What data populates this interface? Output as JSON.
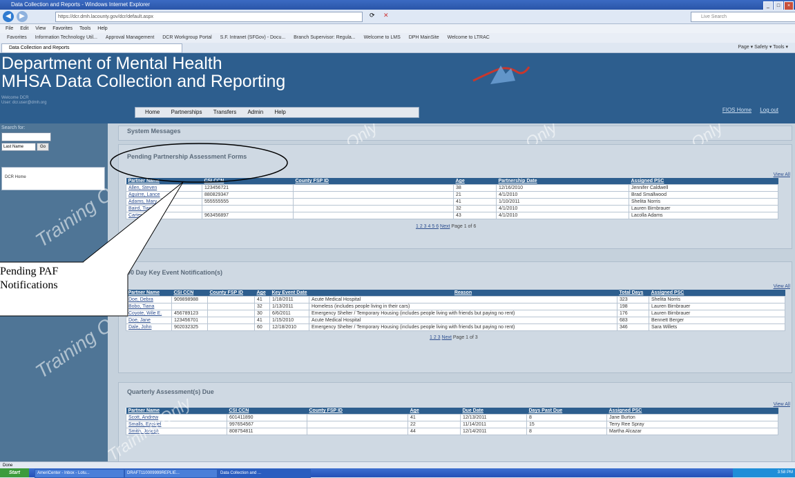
{
  "browser": {
    "title": "Data Collection and Reports - Windows Internet Explorer",
    "url": "https://dcr.dmh.lacounty.gov/dcr/default.aspx",
    "search_placeholder": "Live Search",
    "menu": [
      "File",
      "Edit",
      "View",
      "Favorites",
      "Tools",
      "Help"
    ],
    "favorites": [
      "Favorites",
      "Information Technology Util...",
      "Approval Management",
      "DCR Workgroup Portal",
      "S.F. Intranet (SFGov) - Docu...",
      "Branch Supervisor: Regula...",
      "Welcome to LMS",
      "DPH MainSite",
      "Welcome to LTRAC"
    ],
    "tab_label": "Data Collection and Reports",
    "command_bar": "Page ▾  Safety ▾  Tools ▾",
    "status": "Done"
  },
  "header": {
    "title1": "Department of Mental Health",
    "title2": "MHSA Data Collection and Reporting",
    "user_line1": "Welcome DCR",
    "user_line2": "User: dcr.user@dmh.org",
    "nav": [
      "Home",
      "Partnerships",
      "Transfers",
      "Admin",
      "Help"
    ],
    "links": [
      "FIOS Home",
      "Log out"
    ]
  },
  "sidebar": {
    "search_label": "Search for:",
    "search_select": "Last Name",
    "go": "Go",
    "box_item": "DCR Home"
  },
  "watermark": "Training Only",
  "system_messages": {
    "title": "System Messages"
  },
  "paf": {
    "title": "Pending Partnership Assessment Forms",
    "view_all": "View All",
    "columns": [
      "Partner Name",
      "CSI CCN",
      "County FSP ID",
      "Age",
      "Partnership Date",
      "Assigned PSC"
    ],
    "rows": [
      [
        "Allen, Steven",
        "123456721",
        "",
        "38",
        "12/16/2010",
        "Jennifer Caldwell"
      ],
      [
        "Aguirre, Lance",
        "880829347",
        "",
        "21",
        "4/1/2010",
        "Brad Smallwood"
      ],
      [
        "Adams, Mary",
        "555555555",
        "",
        "41",
        "1/10/2011",
        "Shelita Norris"
      ],
      [
        "Baird, Tiana",
        "",
        "",
        "32",
        "4/1/2010",
        "Lauren Birnbrauer"
      ],
      [
        "Carter, Carlos",
        "963456897",
        "",
        "43",
        "4/1/2010",
        "Lacolla Adams"
      ]
    ],
    "pager_pages": "1 2 3 4 5 6",
    "pager_next": "Next",
    "pager_info": "Page 1 of 6"
  },
  "kev": {
    "title": "90 Day Key Event Notification(s)",
    "view_all": "View All",
    "columns": [
      "Partner Name",
      "CSI CCN",
      "County FSP ID",
      "Age",
      "Key Event Date",
      "Reason",
      "Total Days",
      "Assigned PSC"
    ],
    "rows": [
      [
        "Doe, Debra",
        "909898988",
        "",
        "41",
        "1/18/2011",
        "Acute Medical Hospital",
        "323",
        "Shelita Norris"
      ],
      [
        "Bobo, Tiana",
        "",
        "",
        "32",
        "1/13/2011",
        "Homeless (includes people living in their cars)",
        "198",
        "Lauren Birnbrauer"
      ],
      [
        "Coyote, Wile E.",
        "456789123",
        "",
        "30",
        "6/6/2011",
        "Emergency Shelter / Temporary Housing (includes people living with friends but paying no rent)",
        "176",
        "Lauren Birnbrauer"
      ],
      [
        "Doe, Jane",
        "123456701",
        "",
        "41",
        "1/15/2010",
        "Acute Medical Hospital",
        "683",
        "Bennett Berger"
      ],
      [
        "Dale, John",
        "902032325",
        "",
        "60",
        "12/18/2010",
        "Emergency Shelter / Temporary Housing (includes people living with friends but paying no rent)",
        "346",
        "Sara Willets"
      ]
    ],
    "pager_pages": "1 2 3",
    "pager_next": "Next",
    "pager_info": "Page 1 of 3"
  },
  "qa": {
    "title": "Quarterly Assessment(s) Due",
    "view_all": "View All",
    "columns": [
      "Partner Name",
      "CSI CCN",
      "County FSP ID",
      "Age",
      "Due Date",
      "Days Past Due",
      "Assigned PSC"
    ],
    "rows": [
      [
        "Scott, Andrew",
        "601411890",
        "",
        "41",
        "12/13/2011",
        "8",
        "Jane Burton"
      ],
      [
        "Smalls, Ezekiel",
        "997654567",
        "",
        "22",
        "11/14/2011",
        "15",
        "Terry Ree Spray"
      ],
      [
        "Smith, Joseph",
        "808754811",
        "",
        "44",
        "12/14/2011",
        "8",
        "Martha Alcazar"
      ]
    ]
  },
  "callout": {
    "line1": "Pending PAF",
    "line2": "Notifications"
  },
  "taskbar": {
    "start": "Start",
    "tasks": [
      "AmeriCenter - Inbox - Lotu...",
      "DRAFT110009999REPLIE...",
      "Data Collection and ..."
    ],
    "clock": "3:58 PM"
  }
}
